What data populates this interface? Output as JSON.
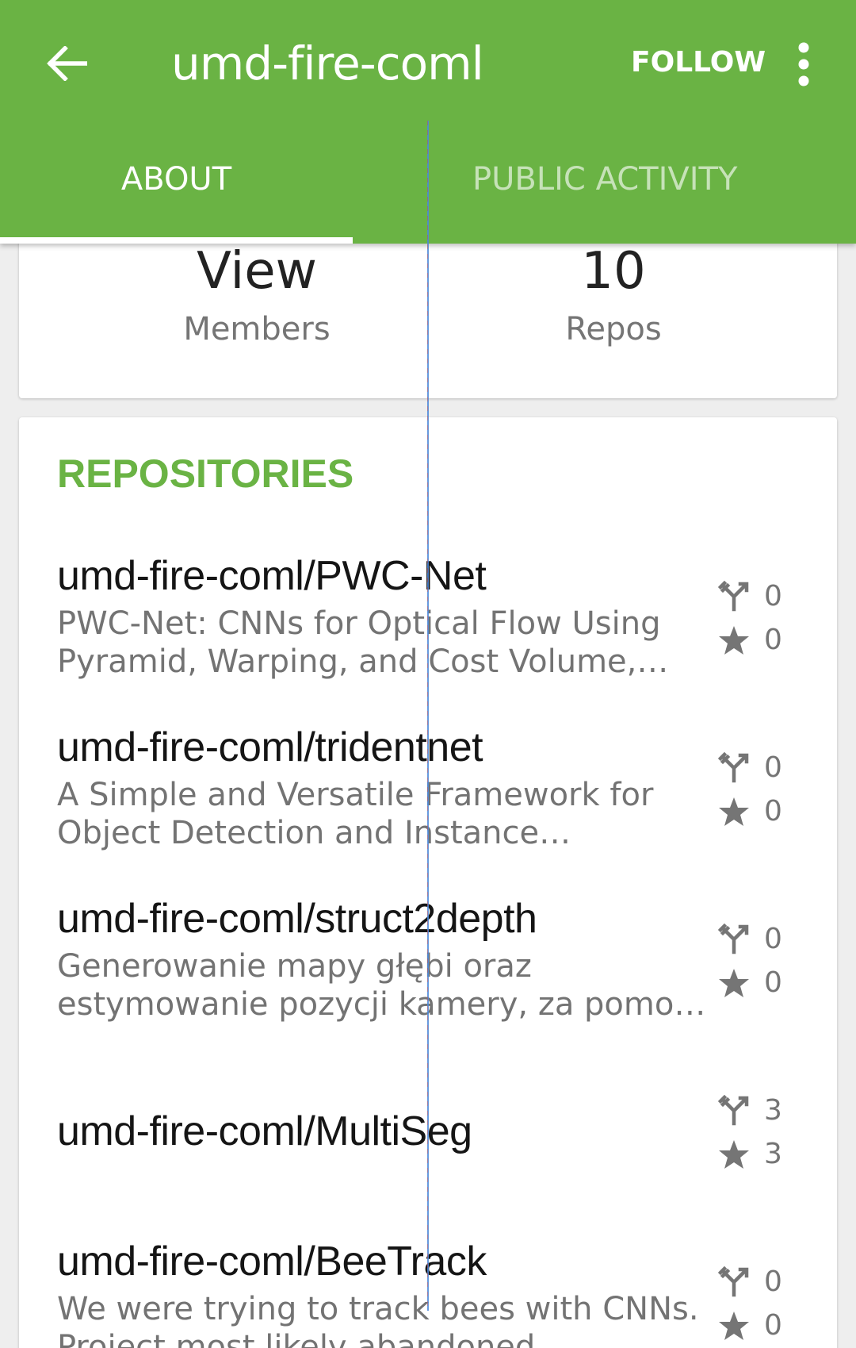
{
  "appbar": {
    "title": "umd-fire-coml",
    "follow_label": "FOLLOW",
    "color": "#6ab344"
  },
  "tabs": [
    {
      "label": "ABOUT",
      "selected": true
    },
    {
      "label": "PUBLIC ACTIVITY",
      "selected": false
    }
  ],
  "stats": {
    "members_value": "View",
    "members_label": "Members",
    "repos_value": "10",
    "repos_label": "Repos"
  },
  "repositories": {
    "section_title": "REPOSITORIES",
    "items": [
      {
        "name": "umd-fire-coml/PWC-Net",
        "description": "PWC-Net: CNNs for Optical Flow Using Pyramid, Warping, and Cost Volume, CVPR …",
        "forks": "0",
        "stars": "0"
      },
      {
        "name": "umd-fire-coml/tridentnet",
        "description": "A Simple and Versatile Framework for Object Detection and Instance Recognition",
        "forks": "0",
        "stars": "0"
      },
      {
        "name": "umd-fire-coml/struct2depth",
        "description": "Generowanie mapy głębi oraz estymowanie pozycji kamery, za pomocą sieci neuronow…",
        "forks": "0",
        "stars": "0"
      },
      {
        "name": "umd-fire-coml/MultiSeg",
        "description": "",
        "forks": "3",
        "stars": "3"
      },
      {
        "name": "umd-fire-coml/BeeTrack",
        "description": "We were trying to track bees with CNNs. Project most likely abandoned",
        "forks": "0",
        "stars": "0"
      }
    ]
  },
  "icons": {
    "back": "arrow-back-icon",
    "overflow": "more-vert-icon",
    "fork": "fork-icon",
    "star": "star-icon"
  }
}
